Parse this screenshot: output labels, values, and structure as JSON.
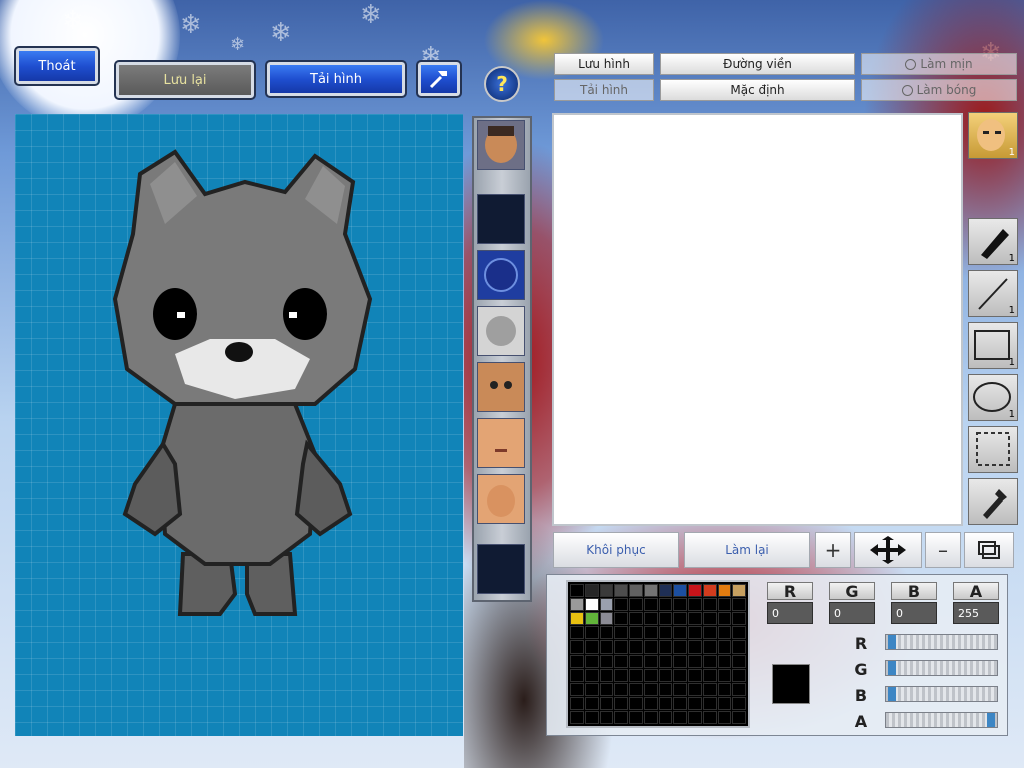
{
  "top_buttons": {
    "exit": "Thoát",
    "save": "Lưu lại",
    "reload": "Tải hình"
  },
  "toolbar": {
    "save_image": "Lưu hình",
    "load_image": "Tải hình",
    "outline": "Đường viền",
    "default": "Mặc định",
    "smooth": "Làm mịn",
    "shine": "Làm bóng"
  },
  "tools": {
    "pen_count": "1",
    "line_count": "1",
    "rect_count": "1",
    "ellipse_count": "1",
    "face_count": "1"
  },
  "bottom": {
    "restore": "Khôi phục",
    "redo": "Làm lại"
  },
  "color": {
    "channels": [
      "R",
      "G",
      "B",
      "A"
    ],
    "values": [
      "0",
      "0",
      "0",
      "255"
    ],
    "current": "#000000",
    "slider_levels": [
      0.02,
      0.02,
      0.02,
      1.0
    ]
  },
  "palette": [
    "#000000",
    "#262626",
    "#3a3a3a",
    "#4d4d4d",
    "#616161",
    "#747474",
    "#1f2f55",
    "#1c4fa0",
    "#c8141a",
    "#d23c1e",
    "#e27c10",
    "#c6a060",
    "#9a9a9a",
    "#ffffff",
    "#9aa0ae",
    "#000000",
    "#000000",
    "#000000",
    "#000000",
    "#000000",
    "#000000",
    "#000000",
    "#000000",
    "#000000",
    "#e8c011",
    "#62b43a",
    "#8b8b94"
  ]
}
